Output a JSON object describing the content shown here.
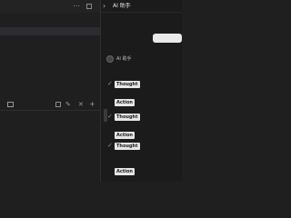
{
  "left": {
    "toolbar": {
      "more_icon": "more-icon",
      "square_icon": "square-icon"
    },
    "bottom_toolbar": {
      "image_label": "",
      "icons": [
        "image-icon",
        "copy-icon",
        "edit-icon",
        "close-icon",
        "plus-icon"
      ]
    }
  },
  "right": {
    "header": {
      "title": "AI 助手",
      "back_icon": "chevron-right-icon"
    },
    "user_message": "",
    "assistant": {
      "name": "AI 助手",
      "meta": ""
    },
    "steps": [
      {
        "tag": "Thought",
        "text": ""
      },
      {
        "tag": "",
        "text": ""
      },
      {
        "tag": "Action",
        "text": ""
      },
      {
        "tag": "Thought",
        "text": ""
      },
      {
        "tag": "",
        "text": ""
      },
      {
        "tag": "Action",
        "text": ""
      },
      {
        "tag": "Thought",
        "text": ""
      },
      {
        "tag": "",
        "text": ""
      },
      {
        "tag": "",
        "text": ""
      },
      {
        "tag": "Action",
        "text": ""
      }
    ],
    "colors": {
      "panel_bg": "#1b1b1b",
      "tag_bg": "#e6e6e6",
      "bubble_bg": "#e9e9e9"
    }
  }
}
